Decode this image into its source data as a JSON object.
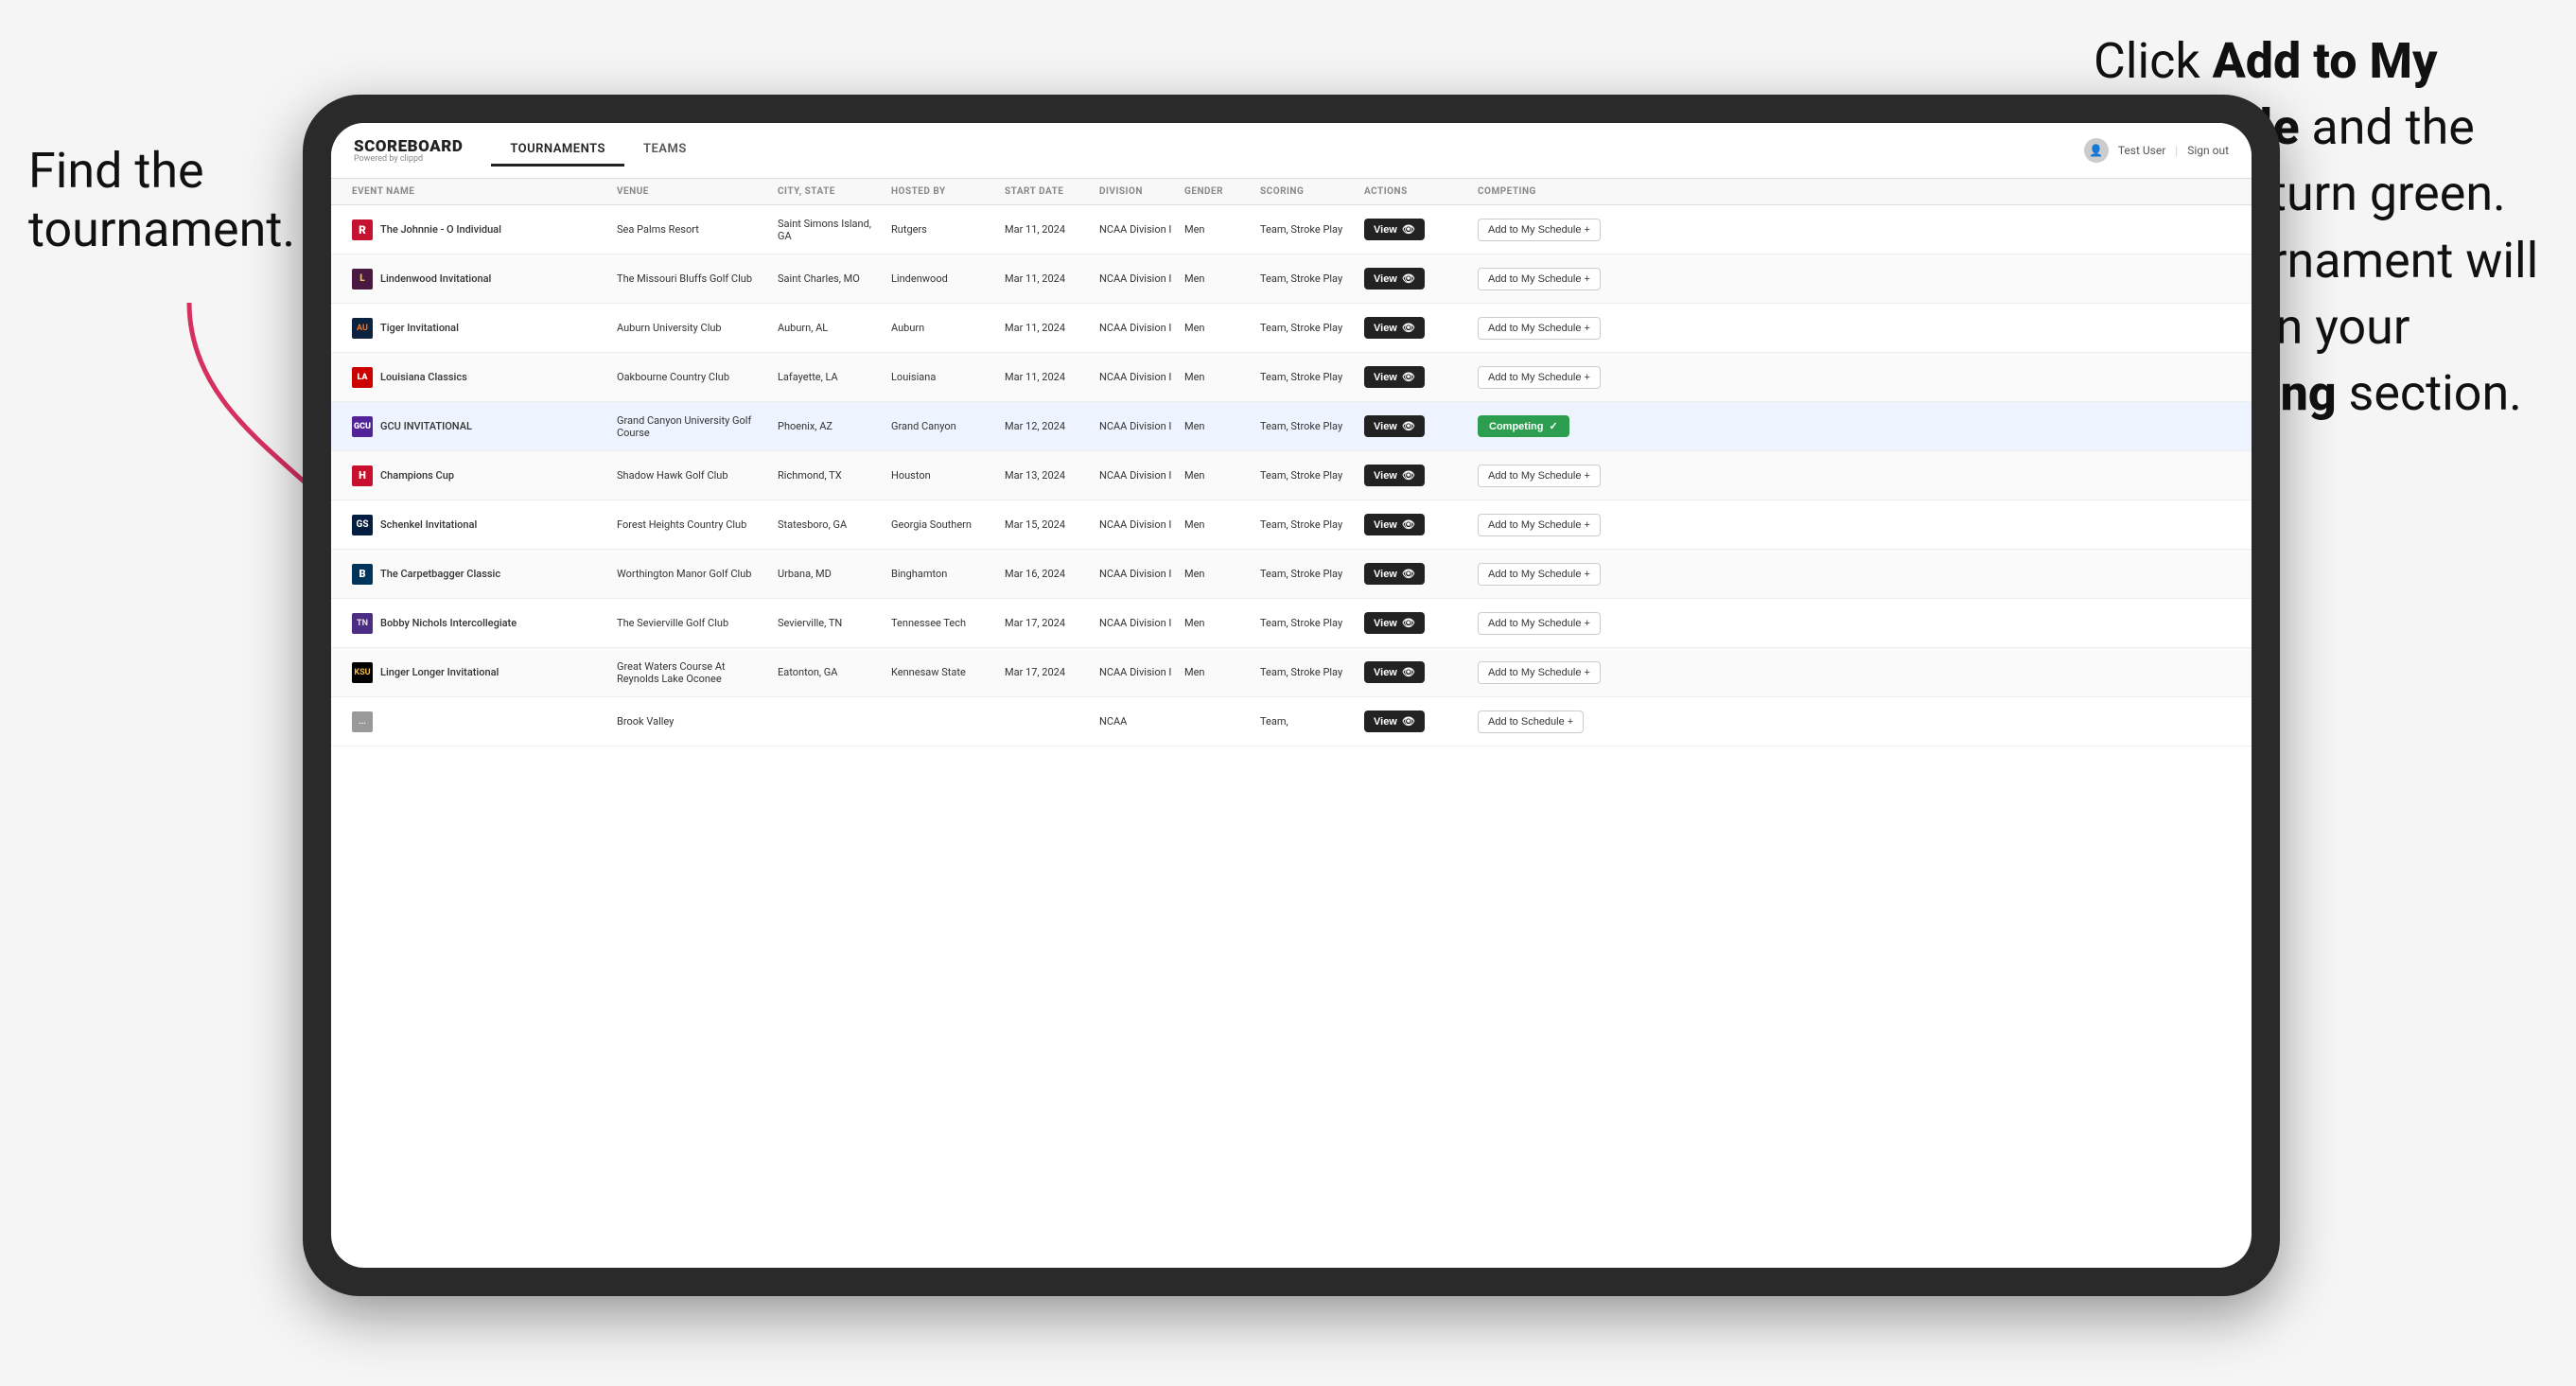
{
  "annotations": {
    "left": "Find the\ntournament.",
    "right_line1": "Click ",
    "right_bold1": "Add to My\nSchedule",
    "right_line2": " and the\nbox will turn green.\nThis tournament\nwill now be in\nyour ",
    "right_bold2": "Competing",
    "right_line3": "\nsection."
  },
  "app": {
    "logo": "SCOREBOARD",
    "logo_sub": "Powered by clippd",
    "nav_tabs": [
      "TOURNAMENTS",
      "TEAMS"
    ],
    "active_tab": "TOURNAMENTS",
    "user_label": "Test User",
    "sign_out": "Sign out"
  },
  "table": {
    "columns": [
      "EVENT NAME",
      "VENUE",
      "CITY, STATE",
      "HOSTED BY",
      "START DATE",
      "DIVISION",
      "GENDER",
      "SCORING",
      "ACTIONS",
      "COMPETING"
    ],
    "rows": [
      {
        "logo_class": "logo-r",
        "logo_text": "R",
        "event": "The Johnnie - O Individual",
        "venue": "Sea Palms Resort",
        "city_state": "Saint Simons Island, GA",
        "hosted_by": "Rutgers",
        "start_date": "Mar 11, 2024",
        "division": "NCAA Division I",
        "gender": "Men",
        "scoring": "Team, Stroke Play",
        "view_label": "View",
        "add_label": "Add to My Schedule +",
        "competing": false,
        "highlighted": false
      },
      {
        "logo_class": "logo-l",
        "logo_text": "L",
        "event": "Lindenwood Invitational",
        "venue": "The Missouri Bluffs Golf Club",
        "city_state": "Saint Charles, MO",
        "hosted_by": "Lindenwood",
        "start_date": "Mar 11, 2024",
        "division": "NCAA Division I",
        "gender": "Men",
        "scoring": "Team, Stroke Play",
        "view_label": "View",
        "add_label": "Add to My Schedule +",
        "competing": false,
        "highlighted": false
      },
      {
        "logo_class": "logo-tiger",
        "logo_text": "AU",
        "event": "Tiger Invitational",
        "venue": "Auburn University Club",
        "city_state": "Auburn, AL",
        "hosted_by": "Auburn",
        "start_date": "Mar 11, 2024",
        "division": "NCAA Division I",
        "gender": "Men",
        "scoring": "Team, Stroke Play",
        "view_label": "View",
        "add_label": "Add to My Schedule +",
        "competing": false,
        "highlighted": false
      },
      {
        "logo_class": "logo-la",
        "logo_text": "LA",
        "event": "Louisiana Classics",
        "venue": "Oakbourne Country Club",
        "city_state": "Lafayette, LA",
        "hosted_by": "Louisiana",
        "start_date": "Mar 11, 2024",
        "division": "NCAA Division I",
        "gender": "Men",
        "scoring": "Team, Stroke Play",
        "view_label": "View",
        "add_label": "Add to My Schedule +",
        "competing": false,
        "highlighted": false
      },
      {
        "logo_class": "logo-gcu",
        "logo_text": "GCU",
        "event": "GCU INVITATIONAL",
        "venue": "Grand Canyon University Golf Course",
        "city_state": "Phoenix, AZ",
        "hosted_by": "Grand Canyon",
        "start_date": "Mar 12, 2024",
        "division": "NCAA Division I",
        "gender": "Men",
        "scoring": "Team, Stroke Play",
        "view_label": "View",
        "add_label": "Competing",
        "competing": true,
        "highlighted": true
      },
      {
        "logo_class": "logo-h",
        "logo_text": "H",
        "event": "Champions Cup",
        "venue": "Shadow Hawk Golf Club",
        "city_state": "Richmond, TX",
        "hosted_by": "Houston",
        "start_date": "Mar 13, 2024",
        "division": "NCAA Division I",
        "gender": "Men",
        "scoring": "Team, Stroke Play",
        "view_label": "View",
        "add_label": "Add to My Schedule +",
        "competing": false,
        "highlighted": false
      },
      {
        "logo_class": "logo-gs",
        "logo_text": "GS",
        "event": "Schenkel Invitational",
        "venue": "Forest Heights Country Club",
        "city_state": "Statesboro, GA",
        "hosted_by": "Georgia Southern",
        "start_date": "Mar 15, 2024",
        "division": "NCAA Division I",
        "gender": "Men",
        "scoring": "Team, Stroke Play",
        "view_label": "View",
        "add_label": "Add to My Schedule +",
        "competing": false,
        "highlighted": false
      },
      {
        "logo_class": "logo-b",
        "logo_text": "B",
        "event": "The Carpetbagger Classic",
        "venue": "Worthington Manor Golf Club",
        "city_state": "Urbana, MD",
        "hosted_by": "Binghamton",
        "start_date": "Mar 16, 2024",
        "division": "NCAA Division I",
        "gender": "Men",
        "scoring": "Team, Stroke Play",
        "view_label": "View",
        "add_label": "Add to My Schedule +",
        "competing": false,
        "highlighted": false
      },
      {
        "logo_class": "logo-tn",
        "logo_text": "TN",
        "event": "Bobby Nichols Intercollegiate",
        "venue": "The Sevierville Golf Club",
        "city_state": "Sevierville, TN",
        "hosted_by": "Tennessee Tech",
        "start_date": "Mar 17, 2024",
        "division": "NCAA Division I",
        "gender": "Men",
        "scoring": "Team, Stroke Play",
        "view_label": "View",
        "add_label": "Add to My Schedule +",
        "competing": false,
        "highlighted": false
      },
      {
        "logo_class": "logo-ksu",
        "logo_text": "KSU",
        "event": "Linger Longer Invitational",
        "venue": "Great Waters Course At Reynolds Lake Oconee",
        "city_state": "Eatonton, GA",
        "hosted_by": "Kennesaw State",
        "start_date": "Mar 17, 2024",
        "division": "NCAA Division I",
        "gender": "Men",
        "scoring": "Team, Stroke Play",
        "view_label": "View",
        "add_label": "Add to My Schedule +",
        "competing": false,
        "highlighted": false
      },
      {
        "logo_class": "logo-bottom",
        "logo_text": "...",
        "event": "",
        "venue": "Brook Valley",
        "city_state": "",
        "hosted_by": "",
        "start_date": "",
        "division": "NCAA",
        "gender": "",
        "scoring": "Team,",
        "view_label": "View",
        "add_label": "Add to Schedule +",
        "competing": false,
        "highlighted": false
      }
    ]
  }
}
